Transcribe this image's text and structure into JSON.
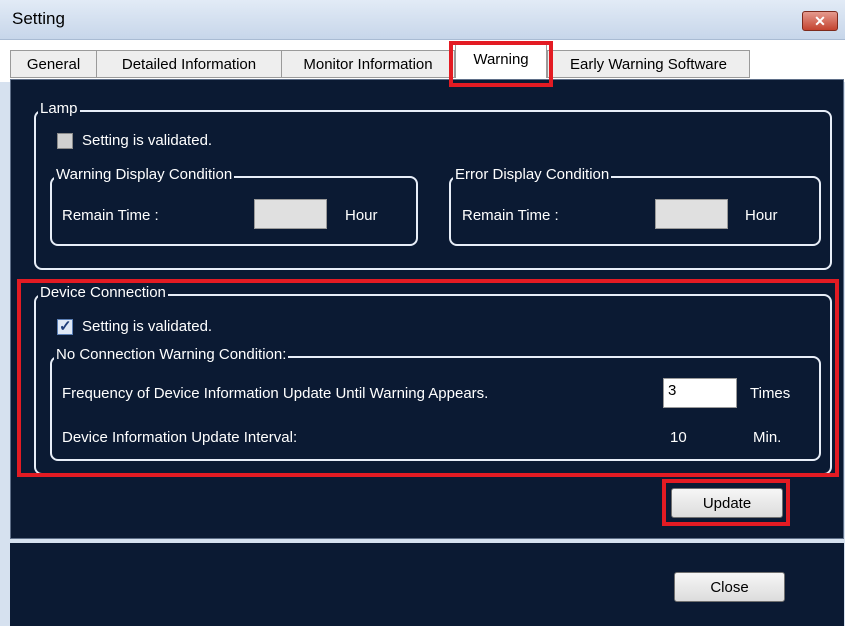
{
  "window": {
    "title": "Setting"
  },
  "tabs": [
    {
      "label": "General"
    },
    {
      "label": "Detailed Information"
    },
    {
      "label": "Monitor Information"
    },
    {
      "label": "Warning"
    },
    {
      "label": "Early Warning Software"
    }
  ],
  "lamp": {
    "legend": "Lamp",
    "checkbox_label": "Setting is validated.",
    "checked": false,
    "warning_group": {
      "legend": "Warning Display Condition",
      "field_label": "Remain Time :",
      "value": "",
      "unit": "Hour"
    },
    "error_group": {
      "legend": "Error Display Condition",
      "field_label": "Remain Time :",
      "value": "",
      "unit": "Hour"
    }
  },
  "device_connection": {
    "legend": "Device Connection",
    "checkbox_label": "Setting is validated.",
    "checked": true,
    "no_connection": {
      "legend": "No Connection Warning Condition:",
      "frequency_label": "Frequency of Device Information Update Until Warning Appears.",
      "frequency_value": "3",
      "frequency_unit": "Times",
      "interval_label": "Device Information Update Interval:",
      "interval_value": "10",
      "interval_unit": "Min."
    }
  },
  "buttons": {
    "update": "Update",
    "close": "Close"
  },
  "colors": {
    "panel_bg": "#0b1a33",
    "highlight": "#e31b23",
    "title_close": "#c4432f"
  },
  "icons": {
    "close": "close-x-icon",
    "check": "check-icon"
  }
}
